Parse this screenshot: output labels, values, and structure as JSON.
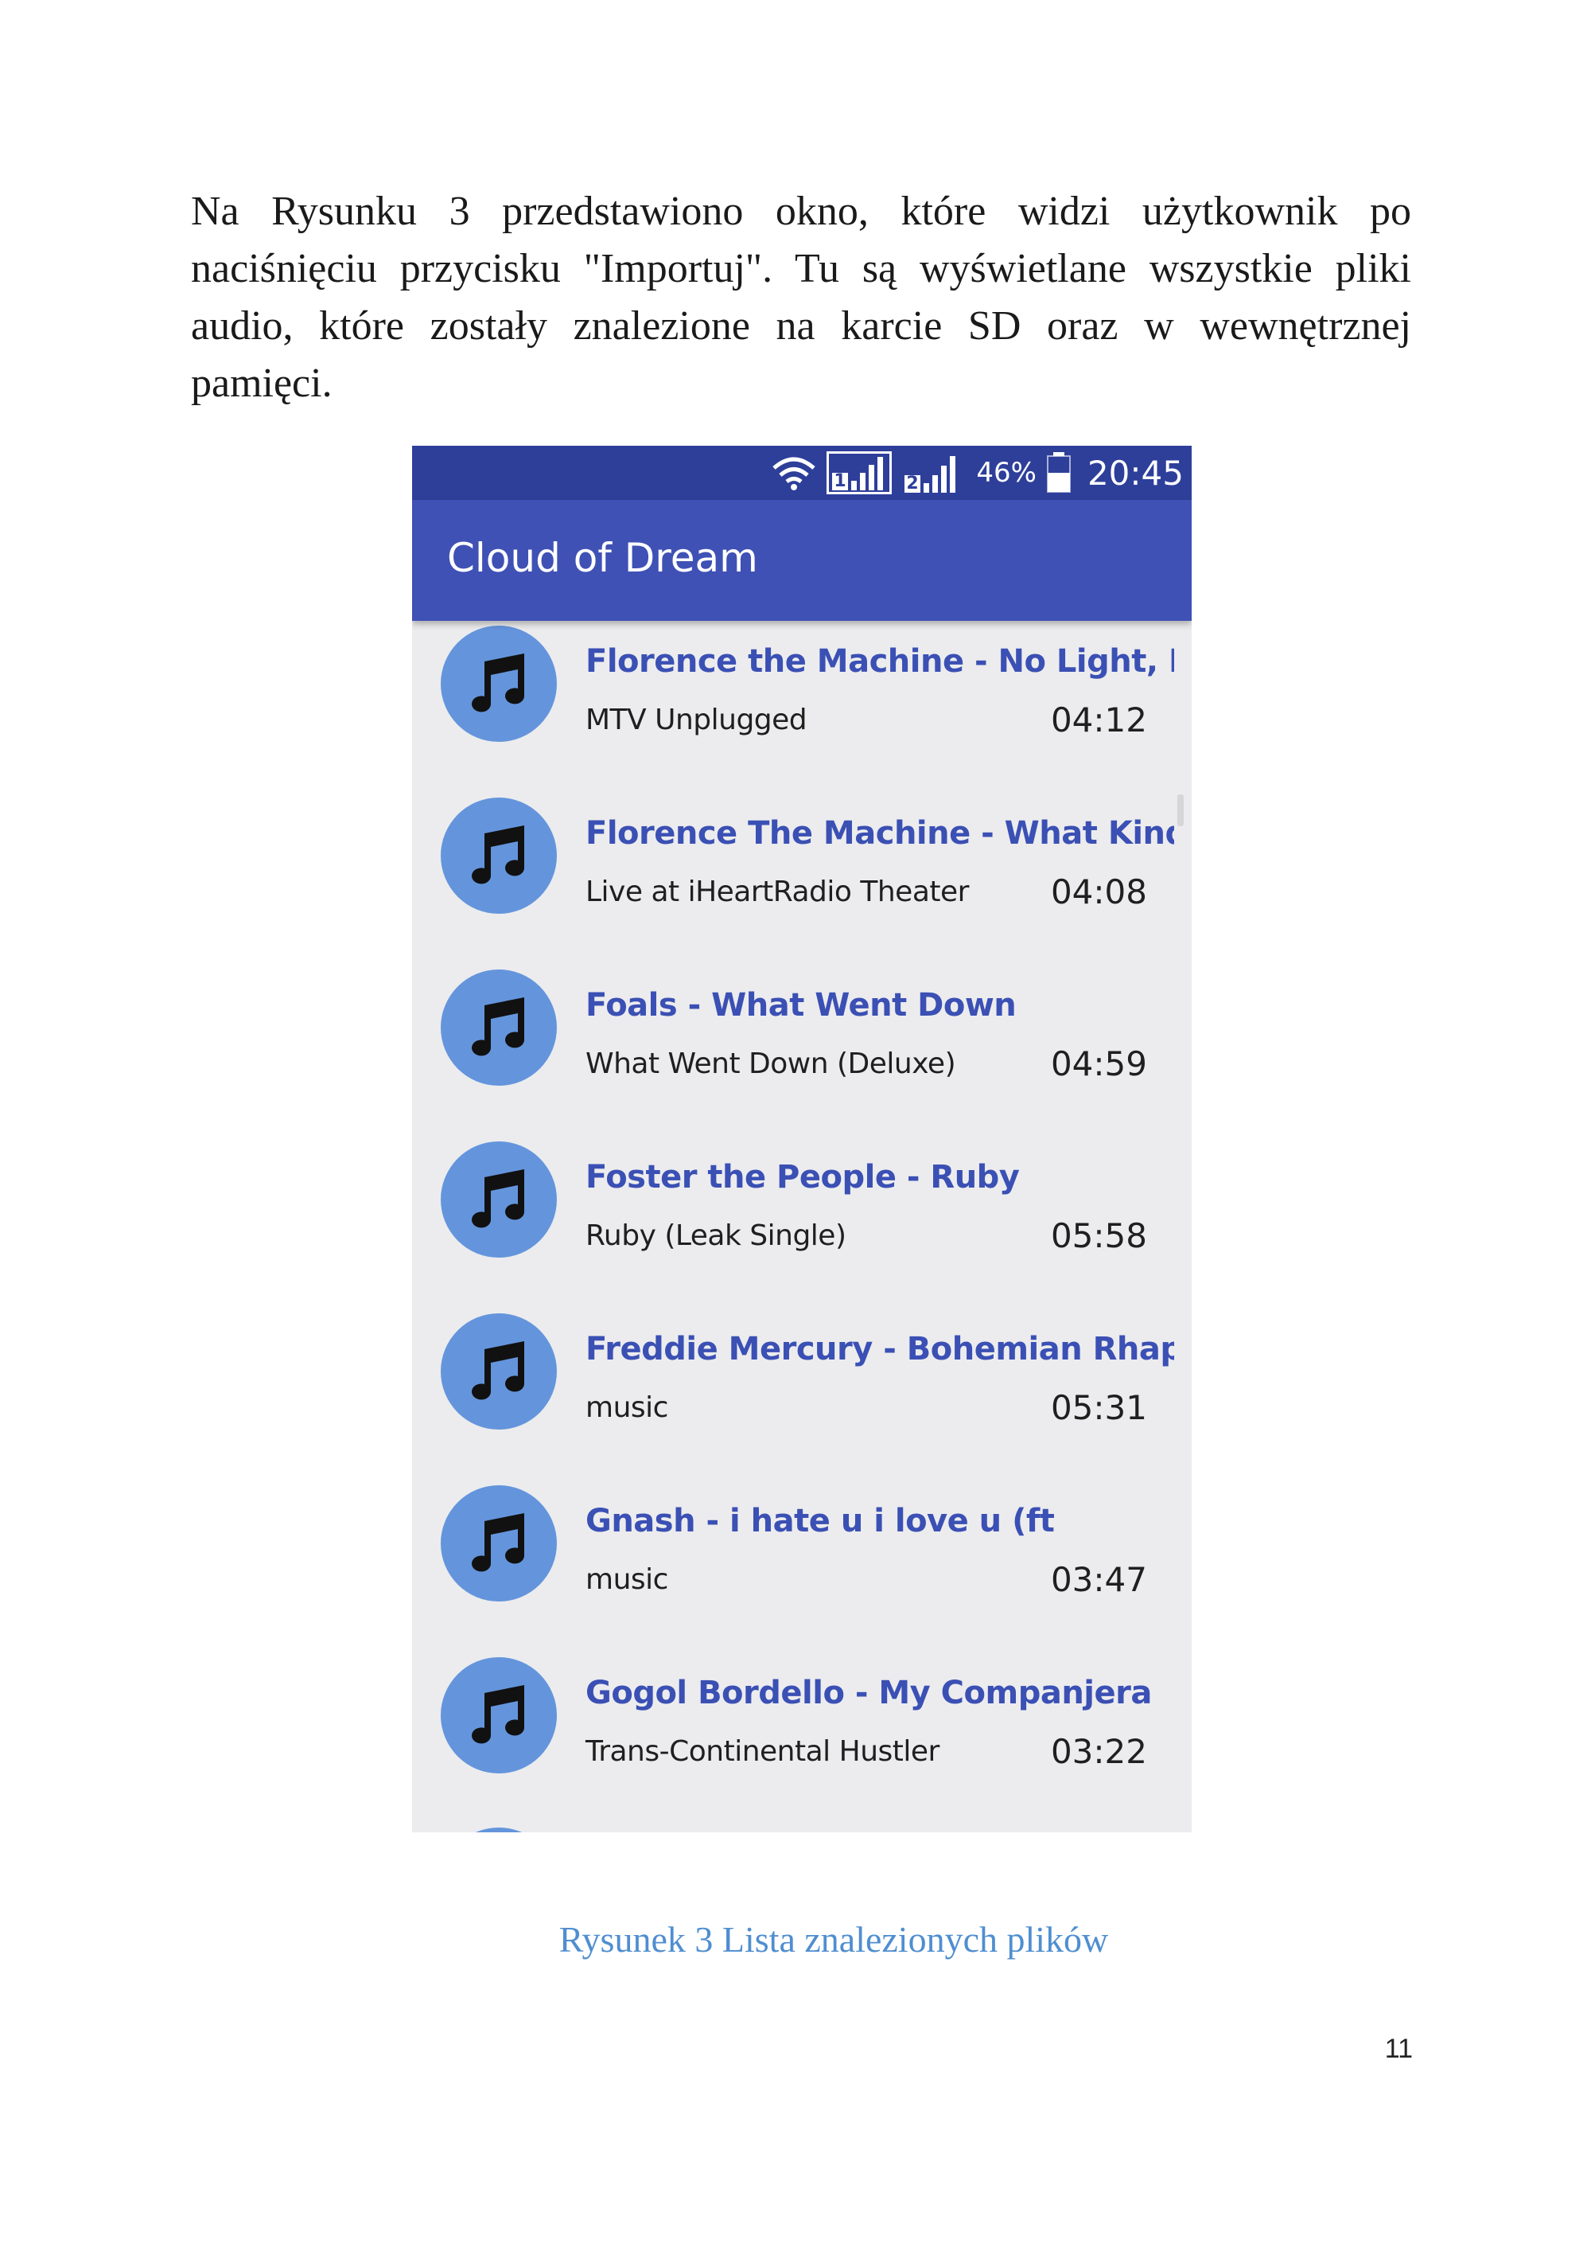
{
  "document": {
    "paragraph": "Na Rysunku 3 przedstawiono okno, które widzi użytkownik po naciśnięciu przycisku \"Importuj\". Tu są wyświetlane wszystkie pliki audio, które zostały znalezione na karcie SD oraz w wewnętrznej pamięci.",
    "caption": "Rysunek 3 Lista znalezionych plików",
    "page_number": "11"
  },
  "phone": {
    "status_bar": {
      "sim1": "1",
      "sim2": "2",
      "battery_percent": "46%",
      "time": "20:45",
      "icons": [
        "wifi-icon",
        "signal-sim1-icon",
        "signal-sim2-icon",
        "battery-icon"
      ]
    },
    "app_title": "Cloud of Dream",
    "song_icon": "music-note-icon",
    "colors": {
      "status_bar": "#2e3f9a",
      "app_bar": "#3f51b5",
      "list_background": "#ececee",
      "avatar": "#6495dc",
      "title_text": "#3b50b4",
      "caption": "#4f8ed0"
    },
    "songs": [
      {
        "title": "Florence the Machine - No Light, No...",
        "album": "MTV Unplugged",
        "duration": "04:12"
      },
      {
        "title": "Florence The Machine - What Kind...",
        "album": "Live at iHeartRadio Theater",
        "duration": "04:08"
      },
      {
        "title": "Foals - What Went Down",
        "album": "What Went Down (Deluxe)",
        "duration": "04:59"
      },
      {
        "title": "Foster the People - Ruby",
        "album": "Ruby (Leak Single)",
        "duration": "05:58"
      },
      {
        "title": "Freddie Mercury - Bohemian Rhaps...",
        "album": "music",
        "duration": "05:31"
      },
      {
        "title": "Gnash - i hate u i love u (ft",
        "album": "music",
        "duration": "03:47"
      },
      {
        "title": "Gogol Bordello - My Companjera",
        "album": "Trans-Continental Hustler",
        "duration": "03:22"
      }
    ]
  }
}
